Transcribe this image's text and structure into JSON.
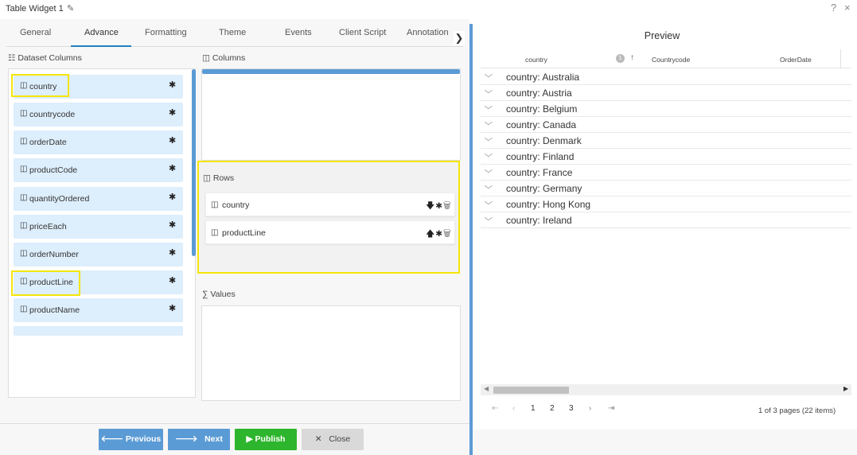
{
  "window": {
    "title": "Table Widget 1",
    "help": "?",
    "close": "×"
  },
  "tabs": [
    "General",
    "Advance",
    "Formatting",
    "Theme",
    "Events",
    "Client Script",
    "Annotation"
  ],
  "dataset": {
    "label": "Dataset Columns",
    "items": [
      "country",
      "countrycode",
      "orderDate",
      "productCode",
      "quantityOrdered",
      "priceEach",
      "orderNumber",
      "productLine",
      "productName"
    ]
  },
  "columns_section": {
    "label": "Columns"
  },
  "rows_section": {
    "label": "Rows",
    "items": [
      {
        "label": "country",
        "arrow": "🡇"
      },
      {
        "label": "productLine",
        "arrow": "🡅"
      }
    ]
  },
  "values_section": {
    "label": "Values"
  },
  "footer": {
    "previous": "Previous",
    "next": "Next",
    "publish": "Publish",
    "close": "Close"
  },
  "preview": {
    "title": "Preview",
    "headers": [
      "country",
      "Countrycode",
      "OrderDate"
    ],
    "sort_badge": "1",
    "groups": [
      "country: Australia",
      "country: Austria",
      "country: Belgium",
      "country: Canada",
      "country: Denmark",
      "country: Finland",
      "country: France",
      "country: Germany",
      "country: Hong Kong",
      "country: Ireland"
    ],
    "pages": [
      "1",
      "2",
      "3"
    ],
    "page_info": "1 of 3 pages (22 items)"
  }
}
